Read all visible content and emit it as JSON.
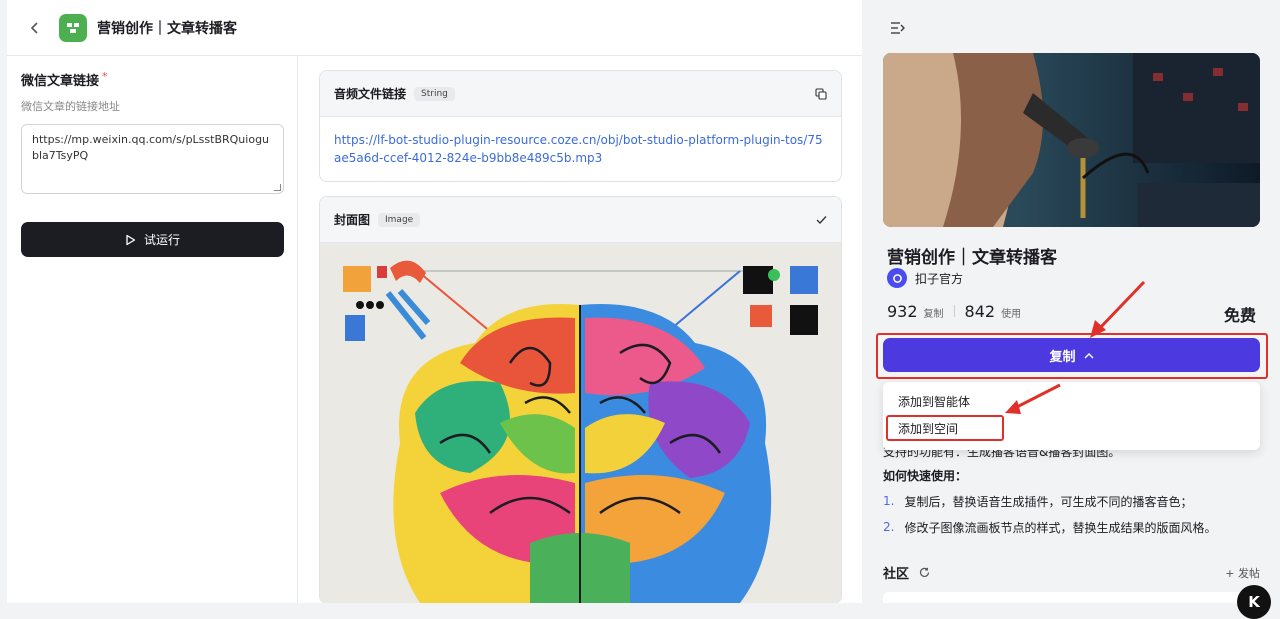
{
  "header": {
    "title": "营销创作｜文章转播客"
  },
  "form": {
    "label": "微信文章链接",
    "required_mark": "*",
    "description": "微信文章的链接地址",
    "url_value": "https://mp.weixin.qq.com/s/pLsstBRQuiogubla7TsyPQ",
    "run_label": "试运行"
  },
  "outputs": {
    "audio": {
      "title": "音频文件链接",
      "type": "String",
      "url": "https://lf-bot-studio-plugin-resource.coze.cn/obj/bot-studio-platform-plugin-tos/75ae5a6d-ccef-4012-824e-b9bb8e489c5b.mp3"
    },
    "cover": {
      "title": "封面图",
      "type": "Image"
    }
  },
  "sidebar": {
    "title": "营销创作｜文章转播客",
    "author": "扣子官方",
    "copies": "932",
    "copies_unit": "复制",
    "uses": "842",
    "uses_unit": "使用",
    "price": "免费",
    "copy_button": "复制",
    "menu": [
      "添加到智能体",
      "添加到空间"
    ],
    "features_partial": "支持的功能有：生成播客语音&播客封面图。",
    "howto_title": "如何快速使用：",
    "steps": [
      {
        "num": "1.",
        "text": "复制后，替换语音生成插件，可生成不同的播客音色；"
      },
      {
        "num": "2.",
        "text": "修改子图像流画板节点的样式，替换生成结果的版面风格。"
      }
    ],
    "community_title": "社区",
    "post_label": "+ 发帖"
  },
  "colors": {
    "primary": "#4d39e0",
    "annotation": "#e0302a",
    "run_button": "#1c1d23",
    "link": "#3b6bd9"
  }
}
